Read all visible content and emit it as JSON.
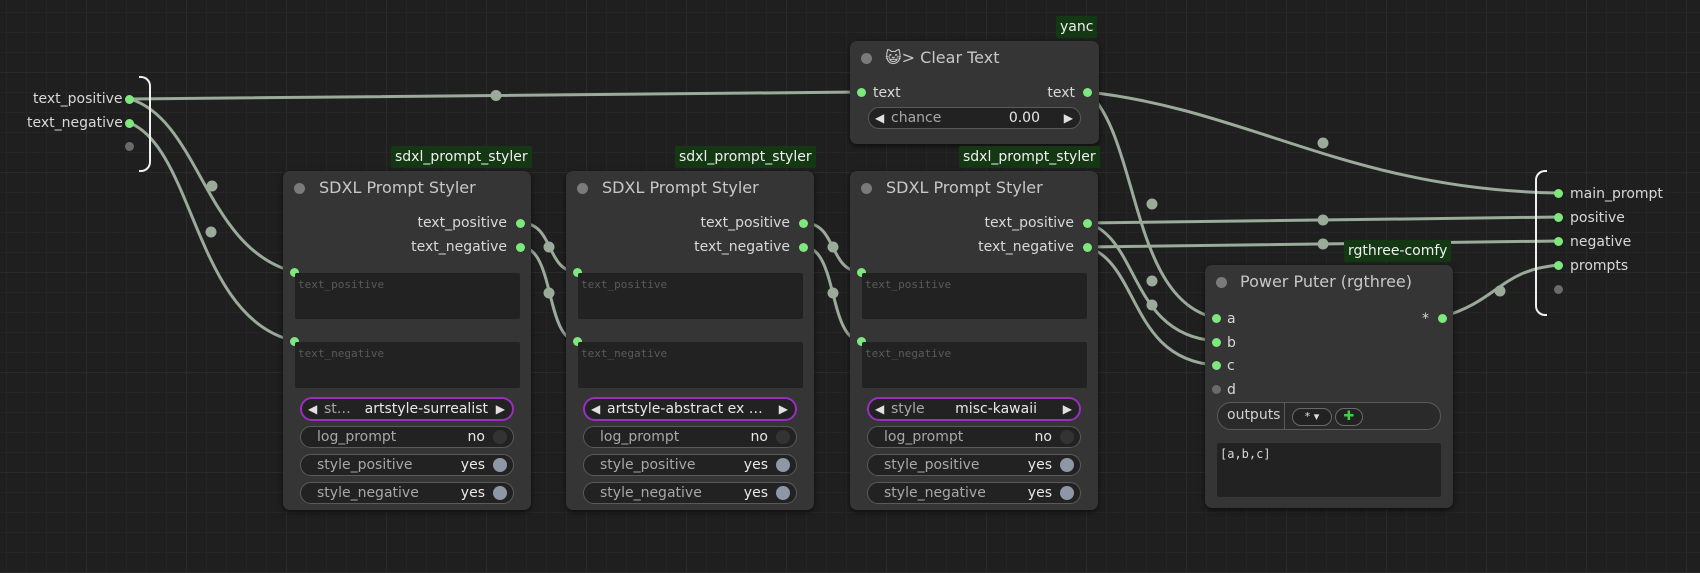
{
  "colors": {
    "link": "#9aab9a",
    "slot_connected": "#7ee77e",
    "slot_empty": "#6a6a6a",
    "combo_border": "#9a2fbf",
    "badge_bg": "#143814"
  },
  "left_group": {
    "slots": [
      "text_positive",
      "text_negative"
    ]
  },
  "right_group": {
    "slots": [
      "main_prompt",
      "positive",
      "negative",
      "prompts"
    ]
  },
  "clear_text": {
    "badge": "yanc",
    "icon": "cat-face-icon",
    "title": "😺> Clear Text",
    "input": "text",
    "output": "text",
    "chance_label": "chance",
    "chance_value": "0.00"
  },
  "stylers": [
    {
      "badge": "sdxl_prompt_styler",
      "title": "SDXL Prompt Styler",
      "out_positive": "text_positive",
      "out_negative": "text_negative",
      "ph_positive": "text_positive",
      "ph_negative": "text_negative",
      "style_label": "st…",
      "style_value": "artstyle-surrealist",
      "log_prompt_label": "log_prompt",
      "log_prompt_value": "no",
      "style_positive_label": "style_positive",
      "style_positive_value": "yes",
      "style_negative_label": "style_negative",
      "style_negative_value": "yes"
    },
    {
      "badge": "sdxl_prompt_styler",
      "title": "SDXL Prompt Styler",
      "out_positive": "text_positive",
      "out_negative": "text_negative",
      "ph_positive": "text_positive",
      "ph_negative": "text_negative",
      "style_label": "",
      "style_value": "artstyle-abstract ex …",
      "log_prompt_label": "log_prompt",
      "log_prompt_value": "no",
      "style_positive_label": "style_positive",
      "style_positive_value": "yes",
      "style_negative_label": "style_negative",
      "style_negative_value": "yes"
    },
    {
      "badge": "sdxl_prompt_styler",
      "title": "SDXL Prompt Styler",
      "out_positive": "text_positive",
      "out_negative": "text_negative",
      "ph_positive": "text_positive",
      "ph_negative": "text_negative",
      "style_label": "style",
      "style_value": "misc-kawaii",
      "log_prompt_label": "log_prompt",
      "log_prompt_value": "no",
      "style_positive_label": "style_positive",
      "style_positive_value": "yes",
      "style_negative_label": "style_negative",
      "style_negative_value": "yes"
    }
  ],
  "power_puter": {
    "badge": "rgthree-comfy",
    "title": "Power Puter (rgthree)",
    "inputs": [
      "a",
      "b",
      "c",
      "d"
    ],
    "output": "*",
    "outputs_label": "outputs",
    "outputs_type": "*",
    "add_icon": "plus-icon",
    "code": "[a,b,c]"
  }
}
